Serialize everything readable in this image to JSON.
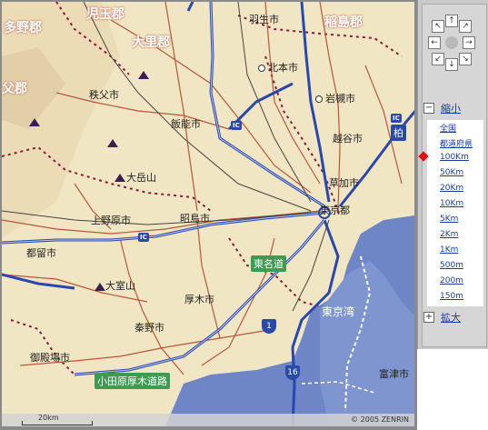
{
  "map": {
    "district_labels": [
      "児玉郡",
      "多野郡",
      "稲島郡",
      "大里郡",
      "父郡"
    ],
    "city_labels": [
      "羽生市",
      "北本市",
      "秩父市",
      "岩槻市",
      "飯能市",
      "越谷市",
      "草加市",
      "大岳山",
      "東京都",
      "上野原市",
      "昭島市",
      "都留市",
      "大室山",
      "厚木市",
      "秦野市",
      "御殿場市",
      "富津市"
    ],
    "road_tags": [
      "東名道",
      "小田原厚木道路",
      "IC",
      "柏"
    ],
    "water_label": "東京湾",
    "route_numbers": [
      "1",
      "16"
    ],
    "scale_label": "20km",
    "copyright": "© 2005 ZENRIN"
  },
  "panel": {
    "nav_arrows": [
      "↖",
      "↑",
      "↗",
      "←",
      "→",
      "↙",
      "↓",
      "↘"
    ],
    "zoom_out_label": "縮小",
    "zoom_in_label": "拡大",
    "scale_levels": [
      "全国",
      "都道府県",
      "100Km",
      "50Km",
      "20Km",
      "10Km",
      "5Km",
      "2Km",
      "1Km",
      "500m",
      "200m",
      "150m"
    ],
    "selected_level": "100Km",
    "marker_color": "#e01010"
  }
}
